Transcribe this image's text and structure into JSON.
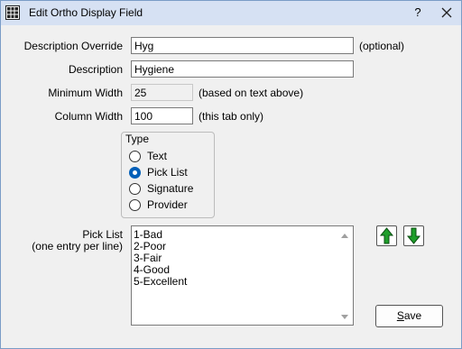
{
  "window": {
    "title": "Edit Ortho Display Field",
    "help_glyph": "?",
    "icons": {
      "app": "grid-icon",
      "close": "close-icon"
    }
  },
  "form": {
    "description_override": {
      "label": "Description Override",
      "value": "Hyg",
      "note": "(optional)"
    },
    "description": {
      "label": "Description",
      "value": "Hygiene"
    },
    "minimum_width": {
      "label": "Minimum Width",
      "value": "25",
      "note": "(based on text above)"
    },
    "column_width": {
      "label": "Column Width",
      "value": "100",
      "note": "(this tab only)"
    }
  },
  "type_group": {
    "title": "Type",
    "options": [
      {
        "label": "Text",
        "checked": false
      },
      {
        "label": "Pick List",
        "checked": true
      },
      {
        "label": "Signature",
        "checked": false
      },
      {
        "label": "Provider",
        "checked": false
      }
    ]
  },
  "pick_list": {
    "label_line1": "Pick List",
    "label_line2": "(one entry per line)",
    "entries": [
      "1-Bad",
      "2-Poor",
      "3-Fair",
      "4-Good",
      "5-Excellent"
    ]
  },
  "buttons": {
    "move_up_icon": "arrow-up-icon",
    "move_down_icon": "arrow-down-icon",
    "save_first": "S",
    "save_rest": "ave"
  },
  "colors": {
    "title_bar": "#d6e1f3",
    "dialog_bg": "#f0f0f0",
    "radio_accent": "#005fb8",
    "arrow_green": "#1e9e2a"
  }
}
